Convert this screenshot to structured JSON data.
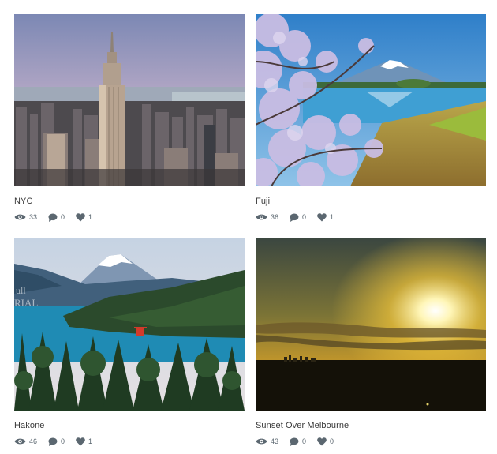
{
  "posts": [
    {
      "title": "NYC",
      "views": "33",
      "comments": "0",
      "likes": "1",
      "image": "nyc-skyline"
    },
    {
      "title": "Fuji",
      "views": "36",
      "comments": "0",
      "likes": "1",
      "image": "fuji-cherry-blossom"
    },
    {
      "title": "Hakone",
      "views": "46",
      "comments": "0",
      "likes": "1",
      "image": "hakone-lake"
    },
    {
      "title": "Sunset Over Melbourne",
      "views": "43",
      "comments": "0",
      "likes": "0",
      "image": "melbourne-sunset"
    }
  ],
  "watermark": "ull\nRIAL",
  "icons": {
    "views": "eye-icon",
    "comments": "speech-bubble-icon",
    "likes": "heart-icon"
  },
  "colors": {
    "icon": "#5b6770",
    "text": "#3a3a3a"
  }
}
